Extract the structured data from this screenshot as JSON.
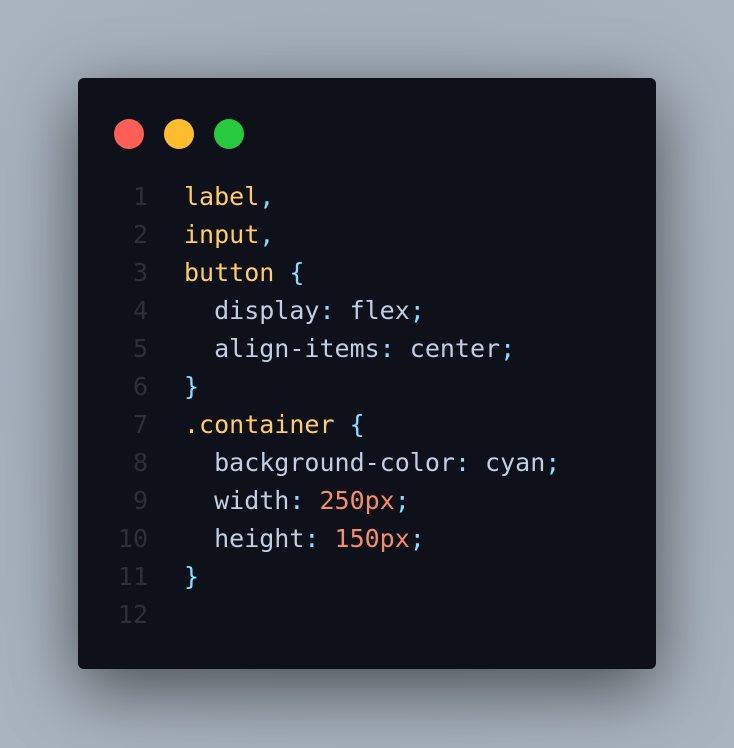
{
  "window": {
    "buttons": {
      "close_color": "#ff5f56",
      "minimize_color": "#ffbd2e",
      "maximize_color": "#27c93f"
    }
  },
  "code": {
    "lines": [
      {
        "num": "1",
        "tokens": [
          {
            "text": "label",
            "type": "sel"
          },
          {
            "text": ",",
            "type": "punc"
          }
        ]
      },
      {
        "num": "2",
        "tokens": [
          {
            "text": "input",
            "type": "sel"
          },
          {
            "text": ",",
            "type": "punc"
          }
        ]
      },
      {
        "num": "3",
        "tokens": [
          {
            "text": "button",
            "type": "sel"
          },
          {
            "text": " ",
            "type": "prop"
          },
          {
            "text": "{",
            "type": "punc"
          }
        ]
      },
      {
        "num": "4",
        "tokens": [
          {
            "text": "  display",
            "type": "prop"
          },
          {
            "text": ": ",
            "type": "punc"
          },
          {
            "text": "flex",
            "type": "val"
          },
          {
            "text": ";",
            "type": "punc"
          }
        ]
      },
      {
        "num": "5",
        "tokens": [
          {
            "text": "  align-items",
            "type": "prop"
          },
          {
            "text": ": ",
            "type": "punc"
          },
          {
            "text": "center",
            "type": "val"
          },
          {
            "text": ";",
            "type": "punc"
          }
        ]
      },
      {
        "num": "6",
        "tokens": [
          {
            "text": "}",
            "type": "punc"
          }
        ]
      },
      {
        "num": "7",
        "tokens": [
          {
            "text": ".container",
            "type": "sel"
          },
          {
            "text": " ",
            "type": "prop"
          },
          {
            "text": "{",
            "type": "punc"
          }
        ]
      },
      {
        "num": "8",
        "tokens": [
          {
            "text": "  background-color",
            "type": "prop"
          },
          {
            "text": ": ",
            "type": "punc"
          },
          {
            "text": "cyan",
            "type": "val"
          },
          {
            "text": ";",
            "type": "punc"
          }
        ]
      },
      {
        "num": "9",
        "tokens": [
          {
            "text": "  width",
            "type": "prop"
          },
          {
            "text": ": ",
            "type": "punc"
          },
          {
            "text": "250px",
            "type": "num"
          },
          {
            "text": ";",
            "type": "punc"
          }
        ]
      },
      {
        "num": "10",
        "tokens": [
          {
            "text": "  height",
            "type": "prop"
          },
          {
            "text": ": ",
            "type": "punc"
          },
          {
            "text": "150px",
            "type": "num"
          },
          {
            "text": ";",
            "type": "punc"
          }
        ]
      },
      {
        "num": "11",
        "tokens": [
          {
            "text": "}",
            "type": "punc"
          }
        ]
      },
      {
        "num": "12",
        "tokens": []
      }
    ]
  }
}
